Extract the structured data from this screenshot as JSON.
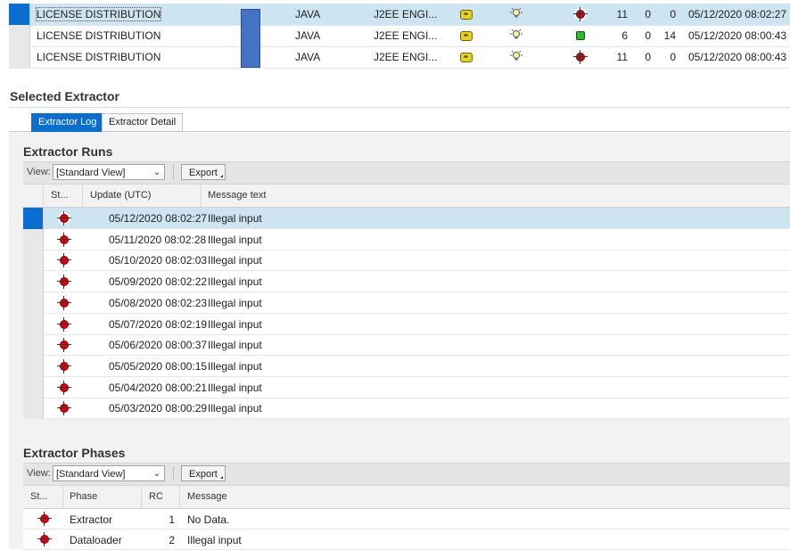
{
  "extractors": {
    "rows": [
      {
        "name": "LICENSE DISTRIBUTION",
        "type": "JAVA",
        "engine": "J2EE ENGI...",
        "status": "red",
        "n1": "11",
        "n2": "0",
        "n3": "0",
        "date": "05/12/2020 08:02:27",
        "selected": true
      },
      {
        "name": "LICENSE DISTRIBUTION",
        "type": "JAVA",
        "engine": "J2EE ENGI...",
        "status": "green",
        "n1": "6",
        "n2": "0",
        "n3": "14",
        "date": "05/12/2020 08:00:43",
        "selected": false
      },
      {
        "name": "LICENSE DISTRIBUTION",
        "type": "JAVA",
        "engine": "J2EE ENGI...",
        "status": "red",
        "n1": "11",
        "n2": "0",
        "n3": "0",
        "date": "05/12/2020 08:00:43",
        "selected": false
      }
    ]
  },
  "selected_extractor": {
    "title": "Selected Extractor",
    "tabs": [
      {
        "label": "Extractor Log",
        "active": true
      },
      {
        "label": "Extractor Detail",
        "active": false
      }
    ]
  },
  "runs": {
    "title": "Extractor Runs",
    "view_label": "View:",
    "view_value": "[Standard View]",
    "export_label": "Export",
    "columns": [
      "St...",
      "Update (UTC)",
      "Message text"
    ],
    "rows": [
      {
        "date": "05/12/2020 08:02:27",
        "message": "Illegal input"
      },
      {
        "date": "05/11/2020 08:02:28",
        "message": "Illegal input"
      },
      {
        "date": "05/10/2020 08:02:03",
        "message": "Illegal input"
      },
      {
        "date": "05/09/2020 08:02:22",
        "message": "Illegal input"
      },
      {
        "date": "05/08/2020 08:02:23",
        "message": "Illegal input"
      },
      {
        "date": "05/07/2020 08:02:19",
        "message": "Illegal input"
      },
      {
        "date": "05/06/2020 08:00:37",
        "message": "Illegal input"
      },
      {
        "date": "05/05/2020 08:00:15",
        "message": "Illegal input"
      },
      {
        "date": "05/04/2020 08:00:21",
        "message": "Illegal input"
      },
      {
        "date": "05/03/2020 08:00:29",
        "message": "Illegal input"
      }
    ]
  },
  "phases": {
    "title": "Extractor Phases",
    "view_label": "View:",
    "view_value": "[Standard View]",
    "export_label": "Export",
    "columns": [
      "St...",
      "Phase",
      "RC",
      "Message"
    ],
    "rows": [
      {
        "phase": "Extractor",
        "rc": "1",
        "message": "No Data."
      },
      {
        "phase": "Dataloader",
        "rc": "2",
        "message": "Illegal input"
      }
    ]
  },
  "colors": {
    "accent": "#0a6ed1",
    "selected_row": "#cde4f1",
    "error": "#e0000f",
    "ok": "#2db82d"
  }
}
